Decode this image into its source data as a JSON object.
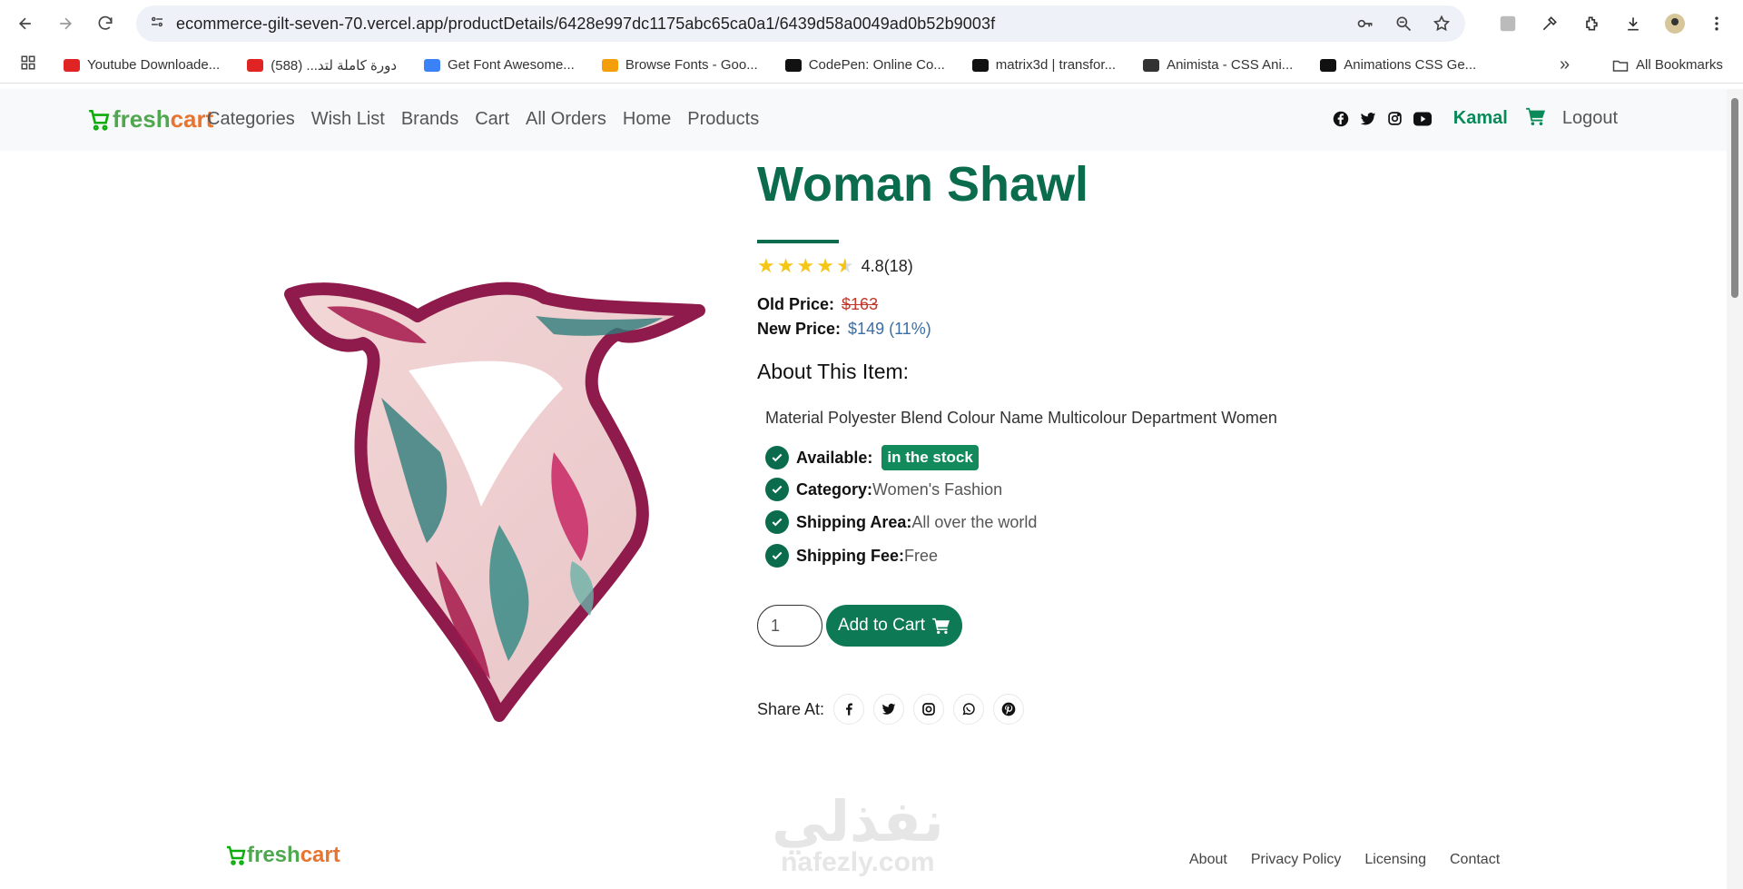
{
  "browser": {
    "url": "ecommerce-gilt-seven-70.vercel.app/productDetails/6428e997dc1175abc65ca0a1/6439d58a0049ad0b52b9003f",
    "bookmarks": [
      {
        "label": "Youtube Downloade...",
        "color": "#e02424"
      },
      {
        "label": "دورة كاملة لتد... (588)",
        "color": "#e02424"
      },
      {
        "label": "Get Font Awesome...",
        "color": "#3b82f6"
      },
      {
        "label": "Browse Fonts - Goo...",
        "color": "#f59e0b"
      },
      {
        "label": "CodePen: Online Co...",
        "color": "#111111"
      },
      {
        "label": "matrix3d | transfor...",
        "color": "#111111"
      },
      {
        "label": "Animista - CSS Ani...",
        "color": "#333333"
      },
      {
        "label": "Animations CSS Ge...",
        "color": "#111111"
      }
    ],
    "more_bookmarks": "»",
    "all_bookmarks": "All Bookmarks"
  },
  "site": {
    "logo_text_1": "fresh",
    "logo_text_2": "cart",
    "nav": [
      "Categories",
      "Wish List",
      "Brands",
      "Cart",
      "All Orders",
      "Home",
      "Products"
    ],
    "user": "Kamal",
    "logout": "Logout"
  },
  "product": {
    "title": "Woman Shawl",
    "rating": "4.8(18)",
    "stars": 4.8,
    "old_price_label": "Old Price:",
    "old_price": "$163",
    "new_price_label": "New Price:",
    "new_price": "$149 (11%)",
    "about_label": "About This Item:",
    "description": "Material Polyester Blend Colour Name Multicolour Department Women",
    "features": [
      {
        "label": "Available:",
        "value": "",
        "badge": "in the stock"
      },
      {
        "label": "Category:",
        "value": "Women's Fashion"
      },
      {
        "label": "Shipping Area:",
        "value": "All over the world"
      },
      {
        "label": "Shipping Fee:",
        "value": "Free"
      }
    ],
    "quantity": "1",
    "add_to_cart": "Add to Cart",
    "share_label": "Share At:",
    "share_icons": [
      "facebook-icon",
      "twitter-icon",
      "instagram-icon",
      "whatsapp-icon",
      "pinterest-icon"
    ]
  },
  "watermark": {
    "ar": "نفذلي",
    "en": "nafezly.com"
  },
  "footer": {
    "links": [
      "About",
      "Privacy Policy",
      "Licensing",
      "Contact"
    ]
  },
  "colors": {
    "primary": "#0a6b4d",
    "accent": "#0aad0a",
    "brand_orange": "#e7742f"
  }
}
